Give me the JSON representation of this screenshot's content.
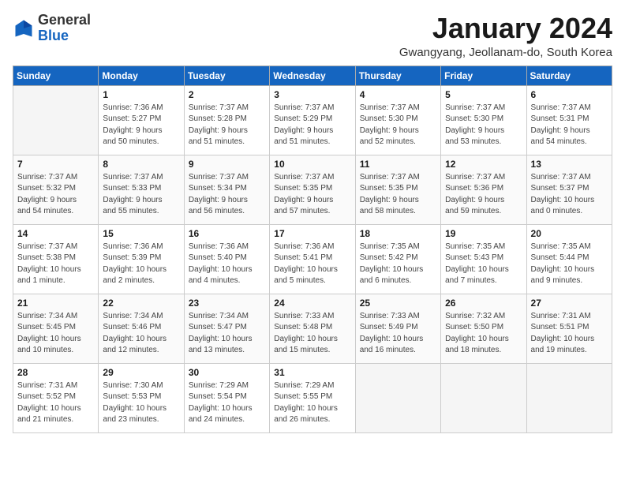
{
  "header": {
    "logo_general": "General",
    "logo_blue": "Blue",
    "month_title": "January 2024",
    "location": "Gwangyang, Jeollanam-do, South Korea"
  },
  "days_of_week": [
    "Sunday",
    "Monday",
    "Tuesday",
    "Wednesday",
    "Thursday",
    "Friday",
    "Saturday"
  ],
  "weeks": [
    [
      {
        "day": "",
        "empty": true
      },
      {
        "day": "1",
        "sunrise": "7:36 AM",
        "sunset": "5:27 PM",
        "daylight": "9 hours and 50 minutes."
      },
      {
        "day": "2",
        "sunrise": "7:37 AM",
        "sunset": "5:28 PM",
        "daylight": "9 hours and 51 minutes."
      },
      {
        "day": "3",
        "sunrise": "7:37 AM",
        "sunset": "5:29 PM",
        "daylight": "9 hours and 51 minutes."
      },
      {
        "day": "4",
        "sunrise": "7:37 AM",
        "sunset": "5:30 PM",
        "daylight": "9 hours and 52 minutes."
      },
      {
        "day": "5",
        "sunrise": "7:37 AM",
        "sunset": "5:30 PM",
        "daylight": "9 hours and 53 minutes."
      },
      {
        "day": "6",
        "sunrise": "7:37 AM",
        "sunset": "5:31 PM",
        "daylight": "9 hours and 54 minutes."
      }
    ],
    [
      {
        "day": "7",
        "sunrise": "7:37 AM",
        "sunset": "5:32 PM",
        "daylight": "9 hours and 54 minutes."
      },
      {
        "day": "8",
        "sunrise": "7:37 AM",
        "sunset": "5:33 PM",
        "daylight": "9 hours and 55 minutes."
      },
      {
        "day": "9",
        "sunrise": "7:37 AM",
        "sunset": "5:34 PM",
        "daylight": "9 hours and 56 minutes."
      },
      {
        "day": "10",
        "sunrise": "7:37 AM",
        "sunset": "5:35 PM",
        "daylight": "9 hours and 57 minutes."
      },
      {
        "day": "11",
        "sunrise": "7:37 AM",
        "sunset": "5:35 PM",
        "daylight": "9 hours and 58 minutes."
      },
      {
        "day": "12",
        "sunrise": "7:37 AM",
        "sunset": "5:36 PM",
        "daylight": "9 hours and 59 minutes."
      },
      {
        "day": "13",
        "sunrise": "7:37 AM",
        "sunset": "5:37 PM",
        "daylight": "10 hours and 0 minutes."
      }
    ],
    [
      {
        "day": "14",
        "sunrise": "7:37 AM",
        "sunset": "5:38 PM",
        "daylight": "10 hours and 1 minute."
      },
      {
        "day": "15",
        "sunrise": "7:36 AM",
        "sunset": "5:39 PM",
        "daylight": "10 hours and 2 minutes."
      },
      {
        "day": "16",
        "sunrise": "7:36 AM",
        "sunset": "5:40 PM",
        "daylight": "10 hours and 4 minutes."
      },
      {
        "day": "17",
        "sunrise": "7:36 AM",
        "sunset": "5:41 PM",
        "daylight": "10 hours and 5 minutes."
      },
      {
        "day": "18",
        "sunrise": "7:35 AM",
        "sunset": "5:42 PM",
        "daylight": "10 hours and 6 minutes."
      },
      {
        "day": "19",
        "sunrise": "7:35 AM",
        "sunset": "5:43 PM",
        "daylight": "10 hours and 7 minutes."
      },
      {
        "day": "20",
        "sunrise": "7:35 AM",
        "sunset": "5:44 PM",
        "daylight": "10 hours and 9 minutes."
      }
    ],
    [
      {
        "day": "21",
        "sunrise": "7:34 AM",
        "sunset": "5:45 PM",
        "daylight": "10 hours and 10 minutes."
      },
      {
        "day": "22",
        "sunrise": "7:34 AM",
        "sunset": "5:46 PM",
        "daylight": "10 hours and 12 minutes."
      },
      {
        "day": "23",
        "sunrise": "7:34 AM",
        "sunset": "5:47 PM",
        "daylight": "10 hours and 13 minutes."
      },
      {
        "day": "24",
        "sunrise": "7:33 AM",
        "sunset": "5:48 PM",
        "daylight": "10 hours and 15 minutes."
      },
      {
        "day": "25",
        "sunrise": "7:33 AM",
        "sunset": "5:49 PM",
        "daylight": "10 hours and 16 minutes."
      },
      {
        "day": "26",
        "sunrise": "7:32 AM",
        "sunset": "5:50 PM",
        "daylight": "10 hours and 18 minutes."
      },
      {
        "day": "27",
        "sunrise": "7:31 AM",
        "sunset": "5:51 PM",
        "daylight": "10 hours and 19 minutes."
      }
    ],
    [
      {
        "day": "28",
        "sunrise": "7:31 AM",
        "sunset": "5:52 PM",
        "daylight": "10 hours and 21 minutes."
      },
      {
        "day": "29",
        "sunrise": "7:30 AM",
        "sunset": "5:53 PM",
        "daylight": "10 hours and 23 minutes."
      },
      {
        "day": "30",
        "sunrise": "7:29 AM",
        "sunset": "5:54 PM",
        "daylight": "10 hours and 24 minutes."
      },
      {
        "day": "31",
        "sunrise": "7:29 AM",
        "sunset": "5:55 PM",
        "daylight": "10 hours and 26 minutes."
      },
      {
        "day": "",
        "empty": true
      },
      {
        "day": "",
        "empty": true
      },
      {
        "day": "",
        "empty": true
      }
    ]
  ]
}
